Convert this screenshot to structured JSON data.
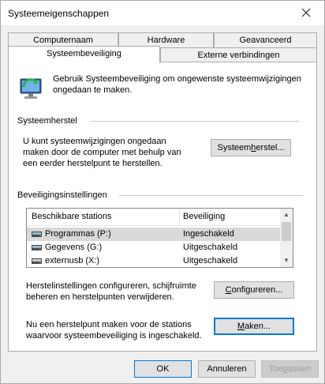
{
  "window": {
    "title": "Systeemeigenschappen"
  },
  "tabs": {
    "row1": [
      "Computernaam",
      "Hardware",
      "Geavanceerd"
    ],
    "row2": [
      "Systeembeveiliging",
      "Externe verbindingen"
    ]
  },
  "intro": {
    "text": "Gebruik Systeembeveiliging om ongewenste systeemwijzigingen ongedaan te maken."
  },
  "restore": {
    "group_title": "Systeemherstel",
    "text": "U kunt systeemwijzigingen ongedaan maken door de computer met behulp van een eerder herstelpunt te herstellen.",
    "button_pre": "Systeem",
    "button_u": "h",
    "button_post": "erstel..."
  },
  "protection": {
    "group_title": "Beveiligingsinstellingen",
    "columns": [
      "Beschikbare stations",
      "Beveiliging"
    ],
    "rows": [
      {
        "drive": "Programmas (P:)",
        "status": "Ingeschakeld"
      },
      {
        "drive": "Gegevens (G:)",
        "status": "Uitgeschakeld"
      },
      {
        "drive": "externusb (X:)",
        "status": "Uitgeschakeld"
      }
    ],
    "selected_row": 0,
    "configure_text": "Herstelinstellingen configureren, schijfruimte beheren en herstelpunten verwijderen.",
    "configure_pre": "",
    "configure_u": "C",
    "configure_post": "onfigureren...",
    "create_text": "Nu een herstelpunt maken voor de stations waarvoor systeembeveiliging is ingeschakeld.",
    "create_pre": "",
    "create_u": "M",
    "create_post": "aken..."
  },
  "footer": {
    "ok": "OK",
    "cancel": "Annuleren",
    "apply_pre": "Toe",
    "apply_u": "p",
    "apply_post": "assen"
  },
  "colors": {
    "accent": "#0078d7",
    "panel": "#ffffff",
    "window": "#f0f0f0"
  }
}
